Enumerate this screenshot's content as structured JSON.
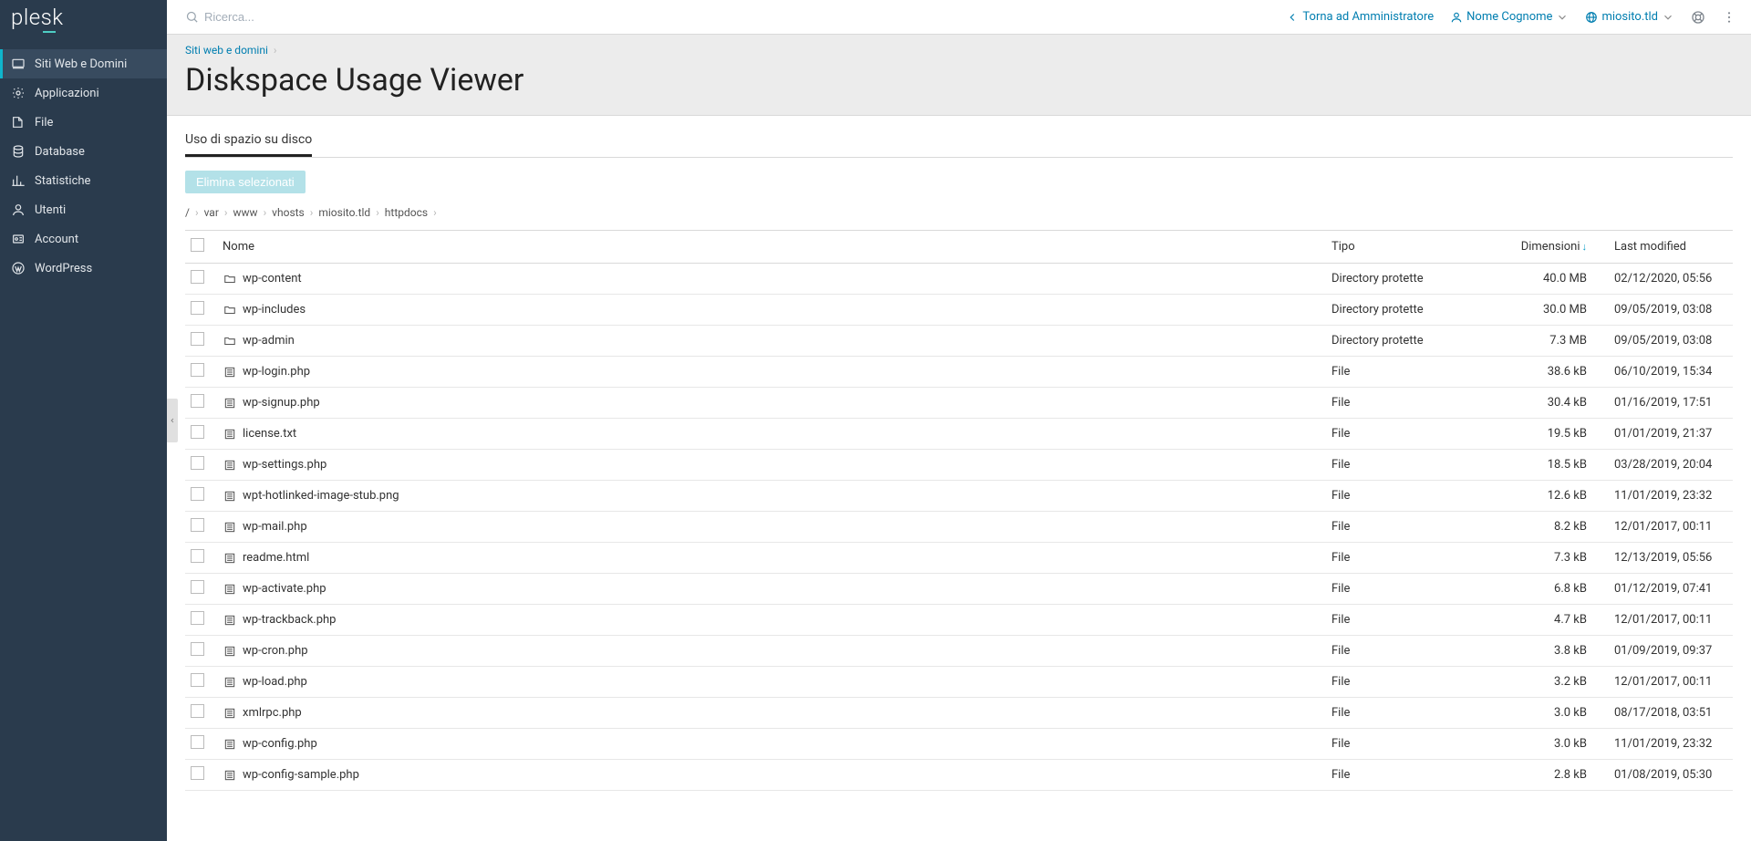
{
  "brand": "plesk",
  "search_placeholder": "Ricerca...",
  "top": {
    "back_admin": "Torna ad Amministratore",
    "user": "Nome Cognome",
    "site": "miosito.tld"
  },
  "nav": [
    {
      "id": "websites",
      "label": "Siti Web e Domini"
    },
    {
      "id": "apps",
      "label": "Applicazioni"
    },
    {
      "id": "file",
      "label": "File"
    },
    {
      "id": "db",
      "label": "Database"
    },
    {
      "id": "stats",
      "label": "Statistiche"
    },
    {
      "id": "users",
      "label": "Utenti"
    },
    {
      "id": "account",
      "label": "Account"
    },
    {
      "id": "wp",
      "label": "WordPress"
    }
  ],
  "breadcrumb_top": "Siti web e domini",
  "page_title": "Diskspace Usage Viewer",
  "tab_label": "Uso di spazio su disco",
  "delete_selected_label": "Elimina selezionati",
  "path": [
    "/",
    "var",
    "www",
    "vhosts",
    "miosito.tld",
    "httpdocs"
  ],
  "columns": {
    "name": "Nome",
    "type": "Tipo",
    "size": "Dimensioni",
    "modified": "Last modified"
  },
  "rows": [
    {
      "icon": "folder",
      "name": "wp-content",
      "type": "Directory protette",
      "size": "40.0 MB",
      "modified": "02/12/2020, 05:56"
    },
    {
      "icon": "folder",
      "name": "wp-includes",
      "type": "Directory protette",
      "size": "30.0 MB",
      "modified": "09/05/2019, 03:08"
    },
    {
      "icon": "folder",
      "name": "wp-admin",
      "type": "Directory protette",
      "size": "7.3 MB",
      "modified": "09/05/2019, 03:08"
    },
    {
      "icon": "file",
      "name": "wp-login.php",
      "type": "File",
      "size": "38.6 kB",
      "modified": "06/10/2019, 15:34"
    },
    {
      "icon": "file",
      "name": "wp-signup.php",
      "type": "File",
      "size": "30.4 kB",
      "modified": "01/16/2019, 17:51"
    },
    {
      "icon": "file",
      "name": "license.txt",
      "type": "File",
      "size": "19.5 kB",
      "modified": "01/01/2019, 21:37"
    },
    {
      "icon": "file",
      "name": "wp-settings.php",
      "type": "File",
      "size": "18.5 kB",
      "modified": "03/28/2019, 20:04"
    },
    {
      "icon": "file",
      "name": "wpt-hotlinked-image-stub.png",
      "type": "File",
      "size": "12.6 kB",
      "modified": "11/01/2019, 23:32"
    },
    {
      "icon": "file",
      "name": "wp-mail.php",
      "type": "File",
      "size": "8.2 kB",
      "modified": "12/01/2017, 00:11"
    },
    {
      "icon": "file",
      "name": "readme.html",
      "type": "File",
      "size": "7.3 kB",
      "modified": "12/13/2019, 05:56"
    },
    {
      "icon": "file",
      "name": "wp-activate.php",
      "type": "File",
      "size": "6.8 kB",
      "modified": "01/12/2019, 07:41"
    },
    {
      "icon": "file",
      "name": "wp-trackback.php",
      "type": "File",
      "size": "4.7 kB",
      "modified": "12/01/2017, 00:11"
    },
    {
      "icon": "file",
      "name": "wp-cron.php",
      "type": "File",
      "size": "3.8 kB",
      "modified": "01/09/2019, 09:37"
    },
    {
      "icon": "file",
      "name": "wp-load.php",
      "type": "File",
      "size": "3.2 kB",
      "modified": "12/01/2017, 00:11"
    },
    {
      "icon": "file",
      "name": "xmlrpc.php",
      "type": "File",
      "size": "3.0 kB",
      "modified": "08/17/2018, 03:51"
    },
    {
      "icon": "file",
      "name": "wp-config.php",
      "type": "File",
      "size": "3.0 kB",
      "modified": "11/01/2019, 23:32"
    },
    {
      "icon": "file",
      "name": "wp-config-sample.php",
      "type": "File",
      "size": "2.8 kB",
      "modified": "01/08/2019, 05:30"
    }
  ]
}
